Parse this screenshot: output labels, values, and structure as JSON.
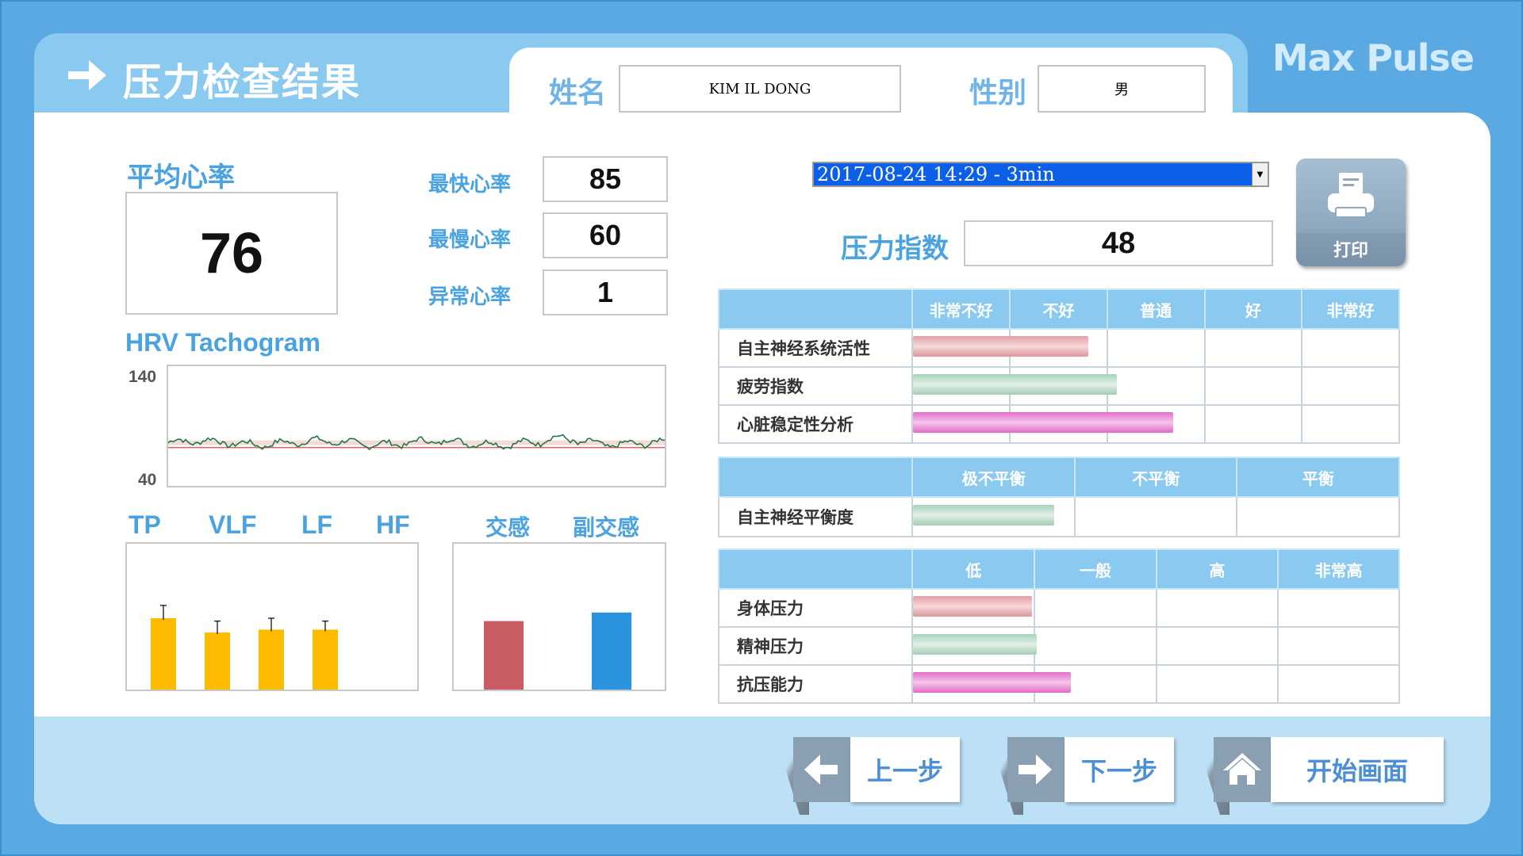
{
  "brand": "Max Pulse",
  "page_title": "压力检查结果",
  "patient": {
    "name_label": "姓名",
    "name_value": "KIM IL DONG",
    "gender_label": "性别",
    "gender_value": "男"
  },
  "heart": {
    "avg_label": "平均心率",
    "avg_value": "76",
    "fastest_label": "最快心率",
    "fastest_value": "85",
    "slowest_label": "最慢心率",
    "slowest_value": "60",
    "abnormal_label": "异常心率",
    "abnormal_value": "1"
  },
  "hrv": {
    "title": "HRV Tachogram",
    "y_max_label": "140",
    "y_min_label": "40",
    "ylim": [
      40,
      140
    ]
  },
  "spectrum": {
    "labels": [
      "TP",
      "VLF",
      "LF",
      "HF"
    ],
    "values": [
      50,
      40,
      42,
      42
    ],
    "errors": [
      9,
      8,
      8,
      6
    ],
    "color": "#ffbb00"
  },
  "ans": {
    "labels": [
      "交感",
      "副交感"
    ],
    "values": [
      48,
      54
    ],
    "colors": [
      "#c95c65",
      "#2a93de"
    ]
  },
  "session": {
    "selected": "2017-08-24 14:29 - 3min"
  },
  "print_label": "打印",
  "stress_index": {
    "label": "压力指数",
    "value": "48"
  },
  "table1": {
    "headers": [
      "非常不好",
      "不好",
      "普通",
      "好",
      "非常好"
    ],
    "rows": [
      {
        "label": "自主神经系统活性",
        "level": 0.36,
        "color": "red"
      },
      {
        "label": "疲劳指数",
        "level": 0.42,
        "color": "green"
      },
      {
        "label": "心脏稳定性分析",
        "level": 0.535,
        "color": "pink"
      }
    ]
  },
  "table2": {
    "headers": [
      "极不平衡",
      "不平衡",
      "平衡"
    ],
    "rows": [
      {
        "label": "自主神经平衡度",
        "level": 0.29,
        "color": "green"
      }
    ]
  },
  "table3": {
    "headers": [
      "低",
      "一般",
      "高",
      "非常高"
    ],
    "rows": [
      {
        "label": "身体压力",
        "level": 0.245,
        "color": "red"
      },
      {
        "label": "精神压力",
        "level": 0.255,
        "color": "green"
      },
      {
        "label": "抗压能力",
        "level": 0.325,
        "color": "pink"
      }
    ]
  },
  "nav": {
    "prev_label": "上一步",
    "next_label": "下一步",
    "home_label": "开始画面"
  }
}
